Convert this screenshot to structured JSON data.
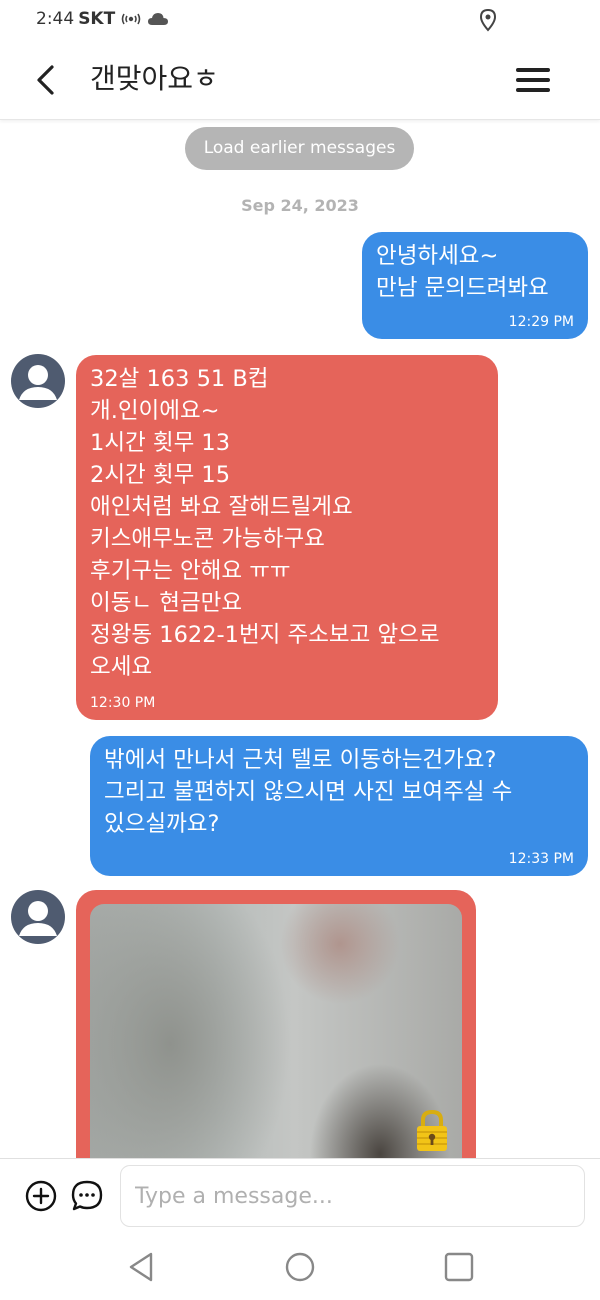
{
  "status_bar": {
    "time": "2:44",
    "carrier": "SKT",
    "icons": [
      "wifi-calling-icon",
      "cloud-icon",
      "location-icon"
    ]
  },
  "header": {
    "title": "갠맞아요ㅎ",
    "back_icon": "back-arrow-icon",
    "menu_icon": "hamburger-menu-icon"
  },
  "messages_area": {
    "load_earlier_label": "Load earlier messages",
    "date_label": "Sep 24, 2023",
    "messages": [
      {
        "direction": "outgoing",
        "text": "안녕하세요~\n만남 문의드려봐요",
        "time": "12:29 PM"
      },
      {
        "direction": "incoming",
        "text": "32살 163 51 B컵\n개.인이에요~\n1시간 횟무 13\n2시간 횟무 15\n애인처럼 봐요 잘해드릴게요\n키스애무노콘 가능하구요\n후기구는 안해요 ㅠㅠ\n이동ㄴ  현금만요\n정왕동 1622-1번지 주소보고 앞으로\n오세요",
        "time": "12:30 PM"
      },
      {
        "direction": "outgoing",
        "text": "밖에서 만나서 근처 텔로 이동하는건가요?\n그리고 불편하지 않으시면 사진 보여주실 수\n있으실까요?",
        "time": "12:33 PM"
      },
      {
        "direction": "incoming",
        "type": "image",
        "blurred": true,
        "lock_icon": "padlock-icon"
      }
    ]
  },
  "input_bar": {
    "placeholder": "Type a message...",
    "value": "",
    "add_icon": "plus-circle-icon",
    "chat_icon": "chat-bubble-icon"
  },
  "nav_bar": {
    "icons": [
      "nav-back-icon",
      "nav-home-icon",
      "nav-recents-icon"
    ]
  },
  "colors": {
    "outgoing_bubble": "#3a8de6",
    "incoming_bubble": "#e5645a",
    "load_earlier_bg": "#b5b5b5",
    "date_text": "#b3b3b3",
    "avatar": "#4f5b70",
    "lock": "#f2c417"
  }
}
